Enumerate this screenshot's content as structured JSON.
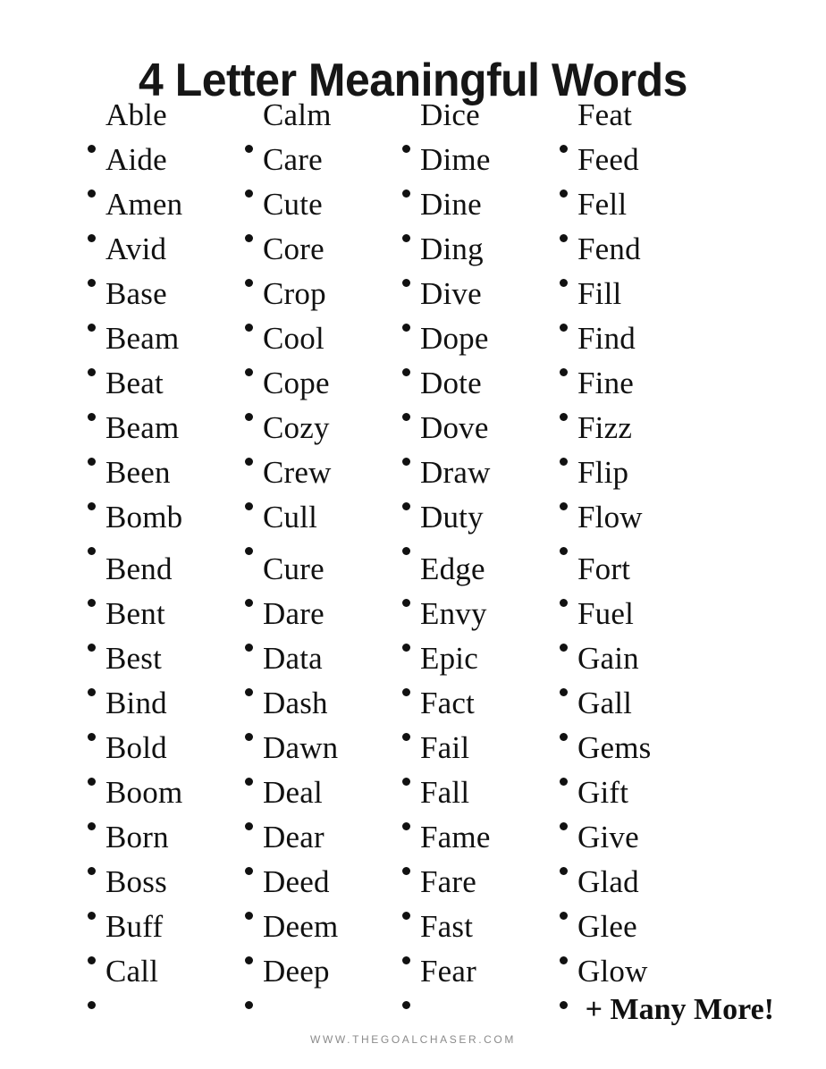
{
  "page": {
    "title": "4 Letter Meaningful Words",
    "background_color": "#ffffff",
    "text_color": "#111111"
  },
  "footer": {
    "many_more_label": "+ Many More!",
    "site_url": "WWW.THEGOALCHASER.COM",
    "site_url_color": "#8b8b8b"
  },
  "columns": [
    {
      "id": "column-1",
      "groups": [
        [
          "Able",
          "Aide",
          "Amen",
          "Avid",
          "Base",
          "Beam",
          "Beat",
          "Beam",
          "Been",
          "Bomb"
        ],
        [
          "Bend",
          "Bent",
          "Best",
          "Bind",
          "Bold",
          "Boom",
          "Born",
          "Boss",
          "Buff",
          "Call"
        ]
      ]
    },
    {
      "id": "column-2",
      "groups": [
        [
          "Calm",
          "Care",
          "Cute",
          "Core",
          "Crop",
          "Cool",
          "Cope",
          "Cozy",
          "Crew",
          "Cull"
        ],
        [
          "Cure",
          "Dare",
          "Data",
          "Dash",
          "Dawn",
          "Deal",
          "Dear",
          "Deed",
          "Deem",
          "Deep"
        ]
      ]
    },
    {
      "id": "column-3",
      "groups": [
        [
          "Dice",
          "Dime",
          "Dine",
          "Ding",
          "Dive",
          "Dope",
          "Dote",
          "Dove",
          "Draw",
          "Duty"
        ],
        [
          "Edge",
          "Envy",
          "Epic",
          "Fact",
          "Fail",
          "Fall",
          "Fame",
          "Fare",
          "Fast",
          "Fear"
        ]
      ]
    },
    {
      "id": "column-4",
      "groups": [
        [
          "Feat",
          "Feed",
          "Fell",
          "Fend",
          "Fill",
          "Find",
          "Fine",
          "Fizz",
          "Flip",
          "Flow"
        ],
        [
          "Fort",
          "Fuel",
          "Gain",
          "Gall",
          "Gems",
          "Gift",
          "Give",
          "Glad",
          "Glee",
          "Glow"
        ]
      ]
    }
  ]
}
